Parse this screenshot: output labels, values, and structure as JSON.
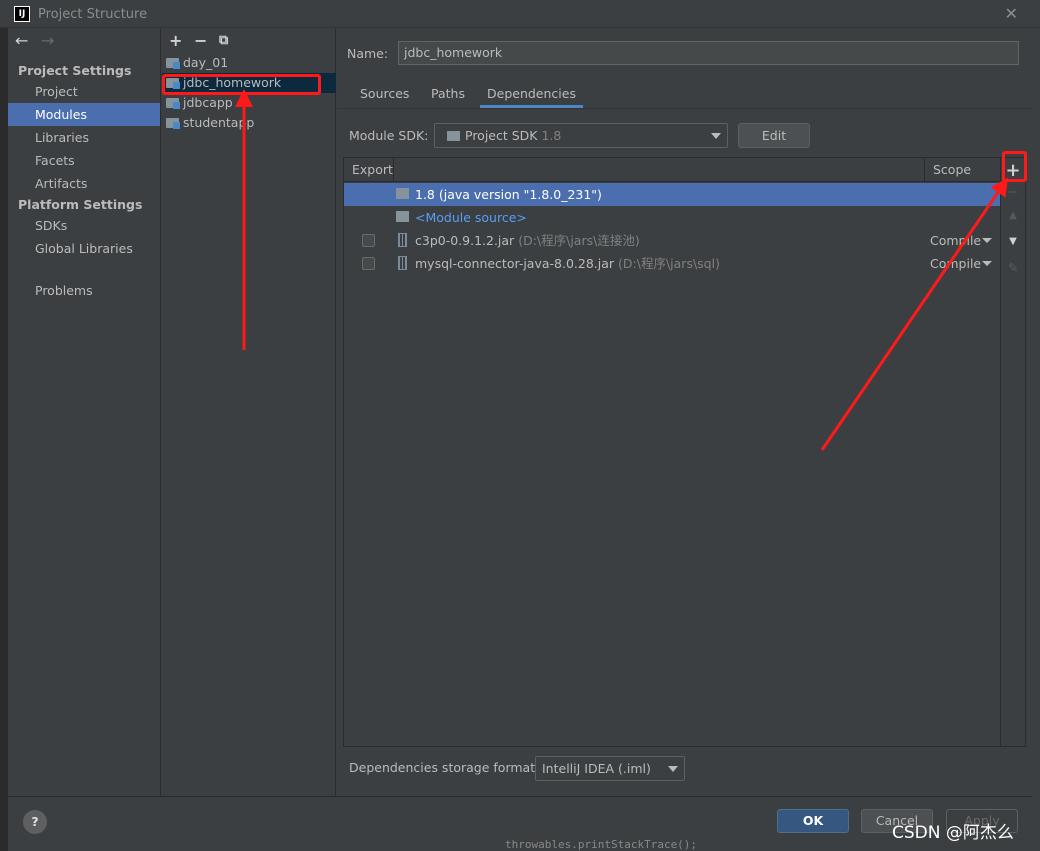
{
  "window": {
    "title": "Project Structure",
    "app_icon": "IJ"
  },
  "sidebar": {
    "sections": [
      {
        "title": "Project Settings",
        "items": [
          "Project",
          "Modules",
          "Libraries",
          "Facets",
          "Artifacts"
        ]
      },
      {
        "title": "Platform Settings",
        "items": [
          "SDKs",
          "Global Libraries"
        ]
      }
    ],
    "problems": "Problems",
    "selected": "Modules"
  },
  "modules": {
    "toolbar": [
      "+",
      "−",
      "⧉"
    ],
    "items": [
      "day_01",
      "jdbc_homework",
      "jdbcapp",
      "studentapp"
    ],
    "selected": "jdbc_homework"
  },
  "details": {
    "name_label": "Name:",
    "name_value": "jdbc_homework",
    "tabs": [
      "Sources",
      "Paths",
      "Dependencies"
    ],
    "active_tab": "Dependencies",
    "sdk_label": "Module SDK:",
    "sdk_value": "Project SDK",
    "sdk_version": "1.8",
    "edit_label": "Edit",
    "table": {
      "headers": {
        "export": "Export",
        "scope": "Scope"
      },
      "rows": [
        {
          "name": "1.8 (java version \"1.8.0_231\")",
          "path": "",
          "scope": "",
          "checkbox": false,
          "selected": true
        },
        {
          "name": "<Module source>",
          "path": "",
          "scope": "",
          "checkbox": false,
          "selected": false
        },
        {
          "name": "c3p0-0.9.1.2.jar",
          "path": "(D:\\程序\\jars\\连接池)",
          "scope": "Compile",
          "checkbox": true,
          "selected": false
        },
        {
          "name": "mysql-connector-java-8.0.28.jar",
          "path": "(D:\\程序\\jars\\sql)",
          "scope": "Compile",
          "checkbox": true,
          "selected": false
        }
      ]
    },
    "storage_label": "Dependencies storage format:",
    "storage_value": "IntelliJ IDEA (.iml)"
  },
  "footer": {
    "help": "?",
    "ok": "OK",
    "cancel": "Cancel",
    "apply": "Apply"
  },
  "background_code": "throwables.printStackTrace();",
  "watermark": "CSDN @阿杰么",
  "colors": {
    "selection": "#4b6eaf",
    "annotation": "#ff1a1a",
    "panel": "#3c3f41"
  }
}
